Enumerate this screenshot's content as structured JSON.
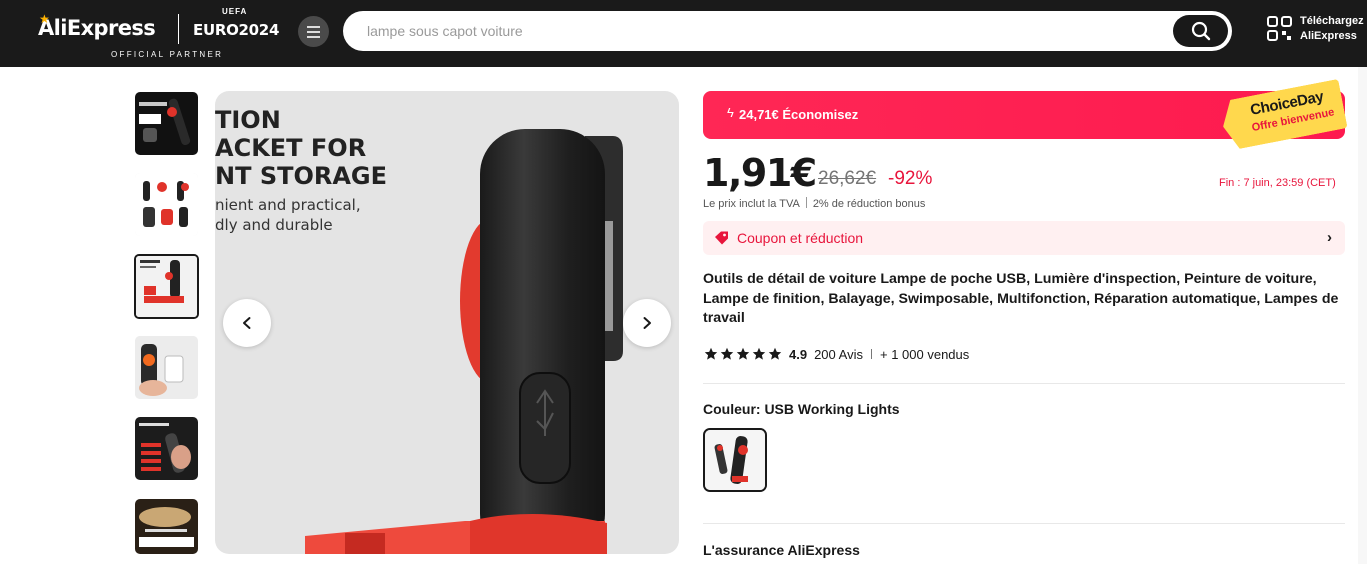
{
  "header": {
    "logo": "AliExpress",
    "logo_star": "★",
    "euro_top": "UEFA",
    "euro": "EURO2024",
    "partner": "OFFICIAL PARTNER",
    "search_placeholder": "lampe sous capot voiture",
    "download_line1": "Téléchargez",
    "download_line2": "AliExpress"
  },
  "gallery": {
    "main_text_line1": "TION",
    "main_text_line2": "ACKET FOR",
    "main_text_line3": "NT STORAGE",
    "main_text_line4": "nient and practical,",
    "main_text_line5": "dly and durable",
    "prev_icon": "chevron-left-icon",
    "next_icon": "chevron-right-icon"
  },
  "promo": {
    "savings": "24,71€ Économisez",
    "badge_title": "ChoiceDay",
    "badge_sub": "Offre bienvenue"
  },
  "price": {
    "current": "1,91€",
    "original": "26,62€",
    "discount": "-92%",
    "ends": "Fin : 7 juin, 23:59 (CET)",
    "vat_note": "Le prix inclut la TVA",
    "bonus_note": "2% de réduction bonus"
  },
  "coupon": {
    "label": "Coupon et réduction"
  },
  "product": {
    "title": "Outils de détail de voiture Lampe de poche USB, Lumière d'inspection, Peinture de voiture, Lampe de finition, Balayage, Swimposable, Multifonction, Réparation automatique, Lampes de travail",
    "rating": "4.9",
    "stars": 5,
    "reviews": "200 Avis",
    "sold": "+ 1 000 vendus",
    "color_label": "Couleur: USB Working Lights",
    "assurance": "L'assurance AliExpress"
  },
  "colors": {
    "brand_red": "#fd1a4f",
    "badge_yellow": "#ffd84d",
    "price_red": "#e8153c"
  }
}
